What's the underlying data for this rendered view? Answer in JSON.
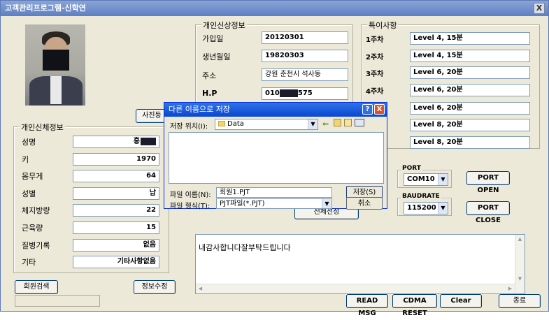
{
  "window": {
    "title": "고객관리프로그램-신학연",
    "close": "X"
  },
  "photo_button": "사진등",
  "body_info": {
    "title": "개인신체정보",
    "rows": [
      {
        "label": "성명",
        "value": "홍"
      },
      {
        "label": "키",
        "value": "1970"
      },
      {
        "label": "몸무게",
        "value": "64"
      },
      {
        "label": "성별",
        "value": "남"
      },
      {
        "label": "체지방량",
        "value": "22"
      },
      {
        "label": "근육량",
        "value": "15"
      },
      {
        "label": "질병기록",
        "value": "없음"
      },
      {
        "label": "기타",
        "value": "기타사항없음"
      }
    ],
    "search_button": "회원검색",
    "edit_button": "정보수정"
  },
  "personal_info": {
    "title": "개인신상정보",
    "rows": [
      {
        "label": "가입일",
        "value": "20120301"
      },
      {
        "label": "생년월일",
        "value": "19820303"
      },
      {
        "label": "주소",
        "value": "강원 춘천시 석사동"
      },
      {
        "label": "H.P",
        "value_prefix": "010",
        "value_suffix": "575"
      }
    ]
  },
  "special": {
    "title": "특이사항",
    "rows": [
      {
        "label": "1주차",
        "value": "Level 4, 15분"
      },
      {
        "label": "2주차",
        "value": "Level 4, 15분"
      },
      {
        "label": "3주차",
        "value": "Level 6, 20분"
      },
      {
        "label": "4주차",
        "value": "Level 6, 20분"
      },
      {
        "label": "",
        "value": "Level 6, 20분"
      },
      {
        "label": "",
        "value": "Level 8, 20분"
      },
      {
        "label": "",
        "value": "Level 8, 20분"
      }
    ]
  },
  "port": {
    "port_title": "PORT",
    "port_value": "COM10",
    "baud_title": "BAUDRATE",
    "baud_value": "115200",
    "open_button": "PORT OPEN",
    "close_button": "PORT CLOSE"
  },
  "middle_button": "전체선정",
  "message": {
    "text": "내감사합니다잘부탁드립니다"
  },
  "bottom": {
    "read_msg": "READ MSG",
    "cdma_reset": "CDMA RESET",
    "clear": "Clear",
    "exit": "종료"
  },
  "dialog": {
    "title": "다른 이름으로 저장",
    "help": "?",
    "close": "X",
    "location_label": "저장 위치(I):",
    "location_value": "Data",
    "filename_label": "파일 이름(N):",
    "filename_value": "회원1.PJT",
    "filetype_label": "파일 형식(T):",
    "filetype_value": "PJT파일(*.PJT)",
    "save_button": "저장(S)",
    "cancel_button": "취소"
  }
}
